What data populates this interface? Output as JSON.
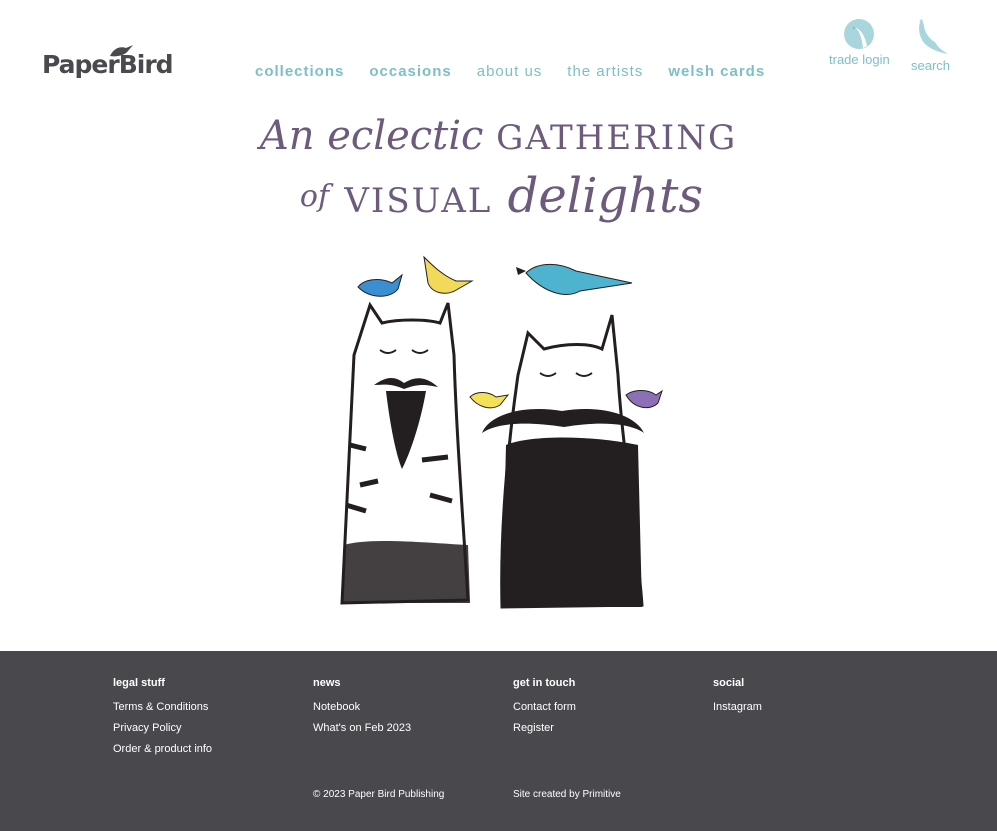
{
  "brand": {
    "logo_text": "PaperBird",
    "accent": "#7dbfc7",
    "headline_color": "#6c5b7d",
    "footer_bg": "#49484d"
  },
  "nav": [
    {
      "label": "collections",
      "bold": true
    },
    {
      "label": "occasions",
      "bold": true
    },
    {
      "label": "about us",
      "bold": false
    },
    {
      "label": "the artists",
      "bold": false
    },
    {
      "label": "welsh cards",
      "bold": true
    }
  ],
  "utility": {
    "trade_login": {
      "label": "trade login",
      "icon": "bird-circle-icon"
    },
    "search": {
      "label": "search",
      "icon": "bird-icon"
    }
  },
  "headline": {
    "w1": "An",
    "w2": "eclectic",
    "w3": "gathering",
    "w4": "of",
    "w5": "visual",
    "w6": "delights"
  },
  "hero": {
    "image": "bearded-cats-with-birds-illustration"
  },
  "footer": {
    "columns": [
      {
        "heading": "legal stuff",
        "links": [
          "Terms & Conditions",
          "Privacy Policy",
          "Order & product info"
        ]
      },
      {
        "heading": "news",
        "links": [
          "Notebook",
          "What's on Feb 2023"
        ]
      },
      {
        "heading": "get in touch",
        "links": [
          "Contact form",
          "Register"
        ]
      },
      {
        "heading": "social",
        "links": [
          "Instagram"
        ]
      }
    ],
    "copyright": "© 2023 Paper Bird Publishing",
    "credit": "Site created by Primitive"
  }
}
